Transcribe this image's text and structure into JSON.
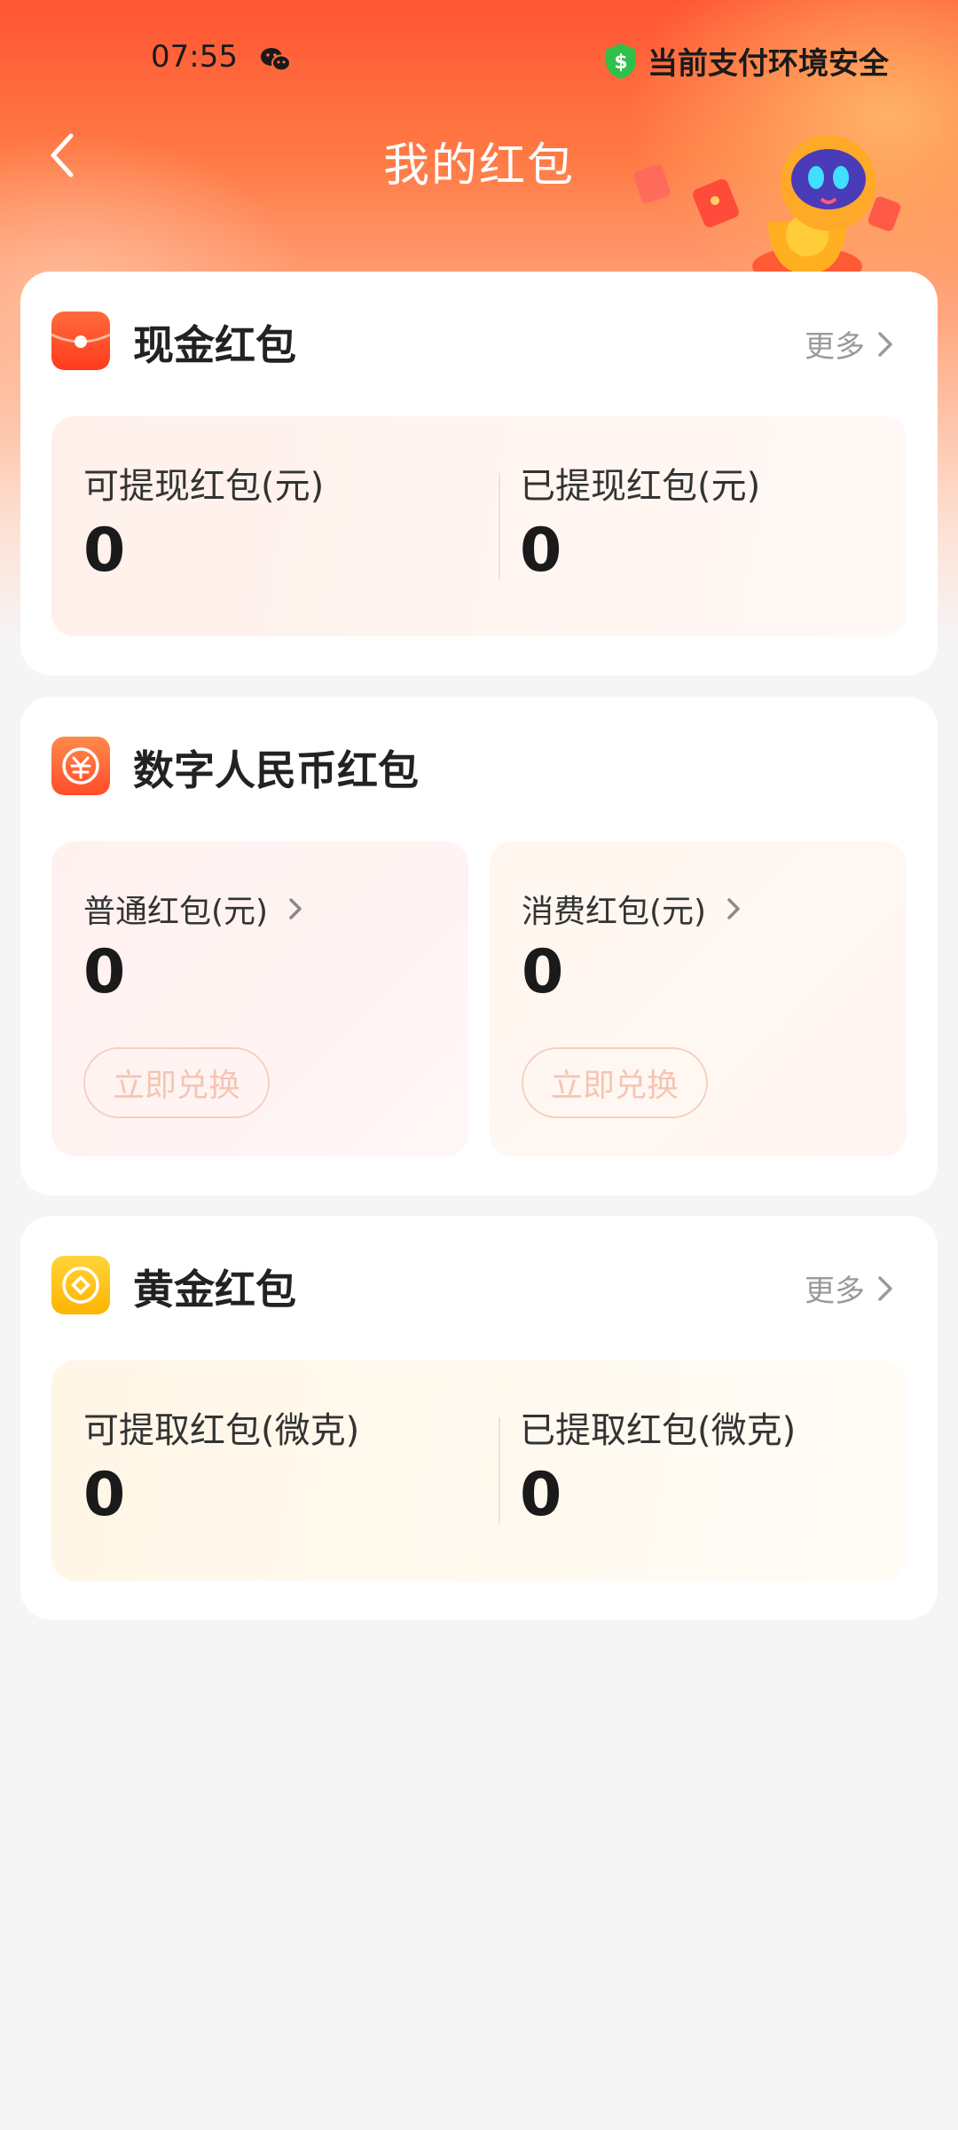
{
  "status_bar": {
    "time": "07:55",
    "secure_text": "当前支付环境安全"
  },
  "header": {
    "title": "我的红包"
  },
  "cash_card": {
    "title": "现金红包",
    "more_label": "更多",
    "stats": [
      {
        "label": "可提现红包(元)",
        "value": "0"
      },
      {
        "label": "已提现红包(元)",
        "value": "0"
      }
    ]
  },
  "ecny_card": {
    "title": "数字人民币红包",
    "panels": [
      {
        "label": "普通红包(元)",
        "value": "0",
        "button": "立即兑换"
      },
      {
        "label": "消费红包(元)",
        "value": "0",
        "button": "立即兑换"
      }
    ]
  },
  "gold_card": {
    "title": "黄金红包",
    "more_label": "更多",
    "stats": [
      {
        "label": "可提取红包(微克)",
        "value": "0"
      },
      {
        "label": "已提取红包(微克)",
        "value": "0"
      }
    ]
  },
  "colors": {
    "brand_orange": "#ff5533",
    "secure_green": "#2fbf4a",
    "gold": "#ffc21a"
  },
  "icons": {
    "back": "chevron-left-icon",
    "wechat": "wechat-icon",
    "secure": "shield-dollar-icon",
    "cash": "red-envelope-icon",
    "ecny": "ecny-coin-icon",
    "gold": "gold-coin-icon",
    "more": "chevron-right-icon"
  }
}
